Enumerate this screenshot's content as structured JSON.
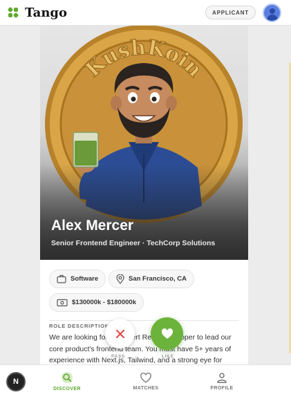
{
  "app": {
    "name": "Tango"
  },
  "header": {
    "role_badge": "APPLICANT"
  },
  "candidate": {
    "name": "Alex Mercer",
    "title": "Senior Frontend Engineer · TechCorp Solutions",
    "coin_text": "KushKoin"
  },
  "chips": {
    "industry": "Software",
    "location": "San Francisco, CA",
    "salary": "$130000k - $180000k"
  },
  "description": {
    "label": "ROLE DESCRIPTION",
    "text": "We are looking for an expert React developer to lead our core product's frontend team. You must have 5+ years of experience with Next.js, Tailwind, and a strong eye for"
  },
  "actions": {
    "pass_label": "PASS",
    "like_label": "LIKE"
  },
  "nav": {
    "items": [
      {
        "label": "DISCOVER",
        "icon": "discover-search-icon",
        "active": true
      },
      {
        "label": "MATCHES",
        "icon": "heart-outline-icon",
        "active": false
      },
      {
        "label": "PROFILE",
        "icon": "user-icon",
        "active": false
      }
    ]
  },
  "dev_badge": "N",
  "colors": {
    "brand_green": "#5fa82d",
    "like_green": "#6bb33a",
    "pass_red": "#e24a4a",
    "coin_gold": "#d4a13c"
  }
}
